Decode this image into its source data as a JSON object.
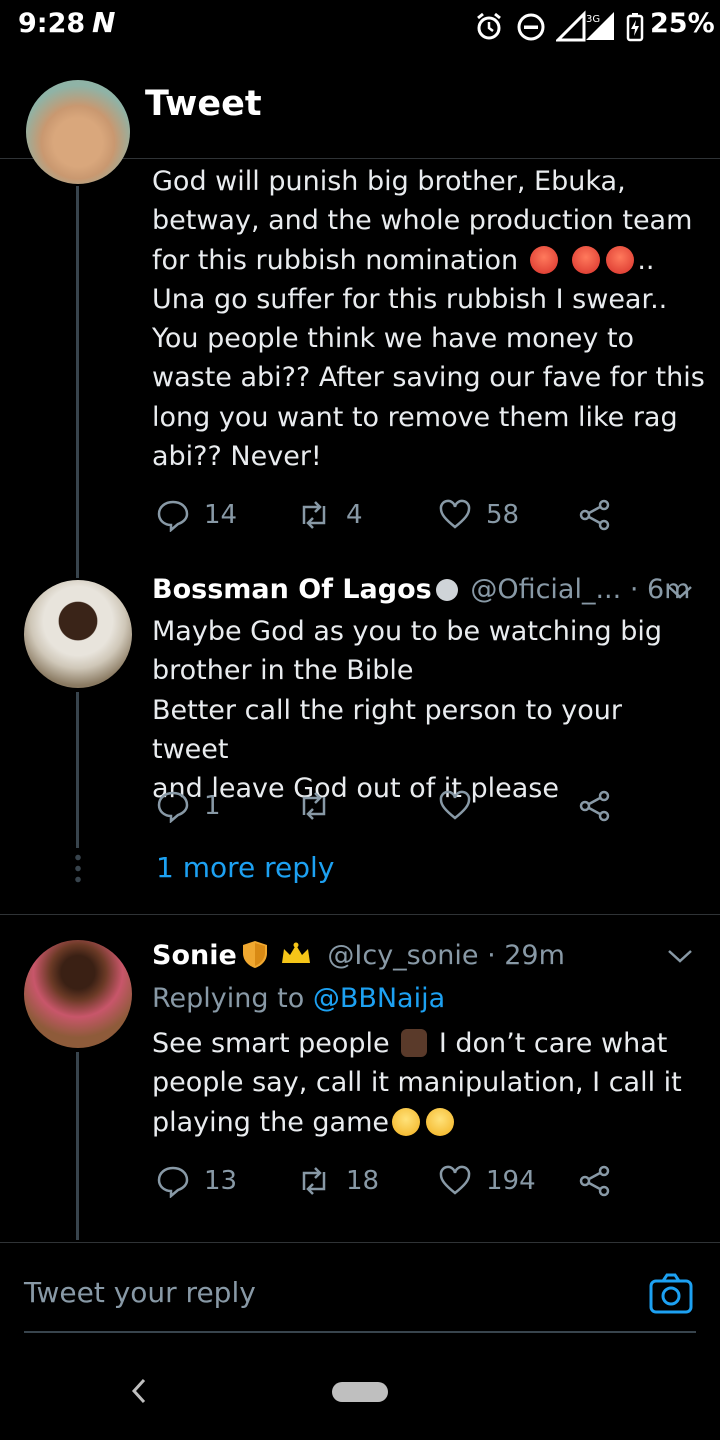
{
  "status_bar": {
    "time": "9:28",
    "net_logo": "N",
    "network": "3G",
    "battery_pct": "25%"
  },
  "header": {
    "title": "Tweet"
  },
  "tweets": [
    {
      "text_lines": [
        "God will punish big brother, Ebuka,",
        "betway, and the whole production team",
        "for this rubbish nomination",
        "Una go suffer for this rubbish I swear..",
        "You people think we have money to",
        "waste abi?? After saving our fave for this",
        "long you want to remove them like rag",
        "abi?? Never!"
      ],
      "trail": "..",
      "replies": "14",
      "retweets": "4",
      "likes": "58"
    },
    {
      "name": "Bossman Of Lagos",
      "handle": "@Oficial_...",
      "time": "· 6m",
      "text_lines": [
        "Maybe God as you to be watching big",
        "brother in the Bible",
        "Better call the right person to your tweet",
        "and leave God out of it please"
      ],
      "replies": "1",
      "retweets": "",
      "likes": "",
      "more_replies": "1 more reply"
    },
    {
      "name": "Sonie",
      "handle": "@Icy_sonie",
      "time": "· 29m",
      "replying_prefix": "Replying to",
      "replying_to": "@BBNaija",
      "line1_a": "See smart people",
      "line1_b": "I don’t care what",
      "line2": "people say, call it manipulation, I call it",
      "line3": "playing the game",
      "replies": "13",
      "retweets": "18",
      "likes": "194"
    }
  ],
  "reply_bar": {
    "placeholder": "Tweet your reply"
  },
  "colors": {
    "accent": "#1da1f2",
    "muted": "#8899a6",
    "background": "#000000"
  }
}
